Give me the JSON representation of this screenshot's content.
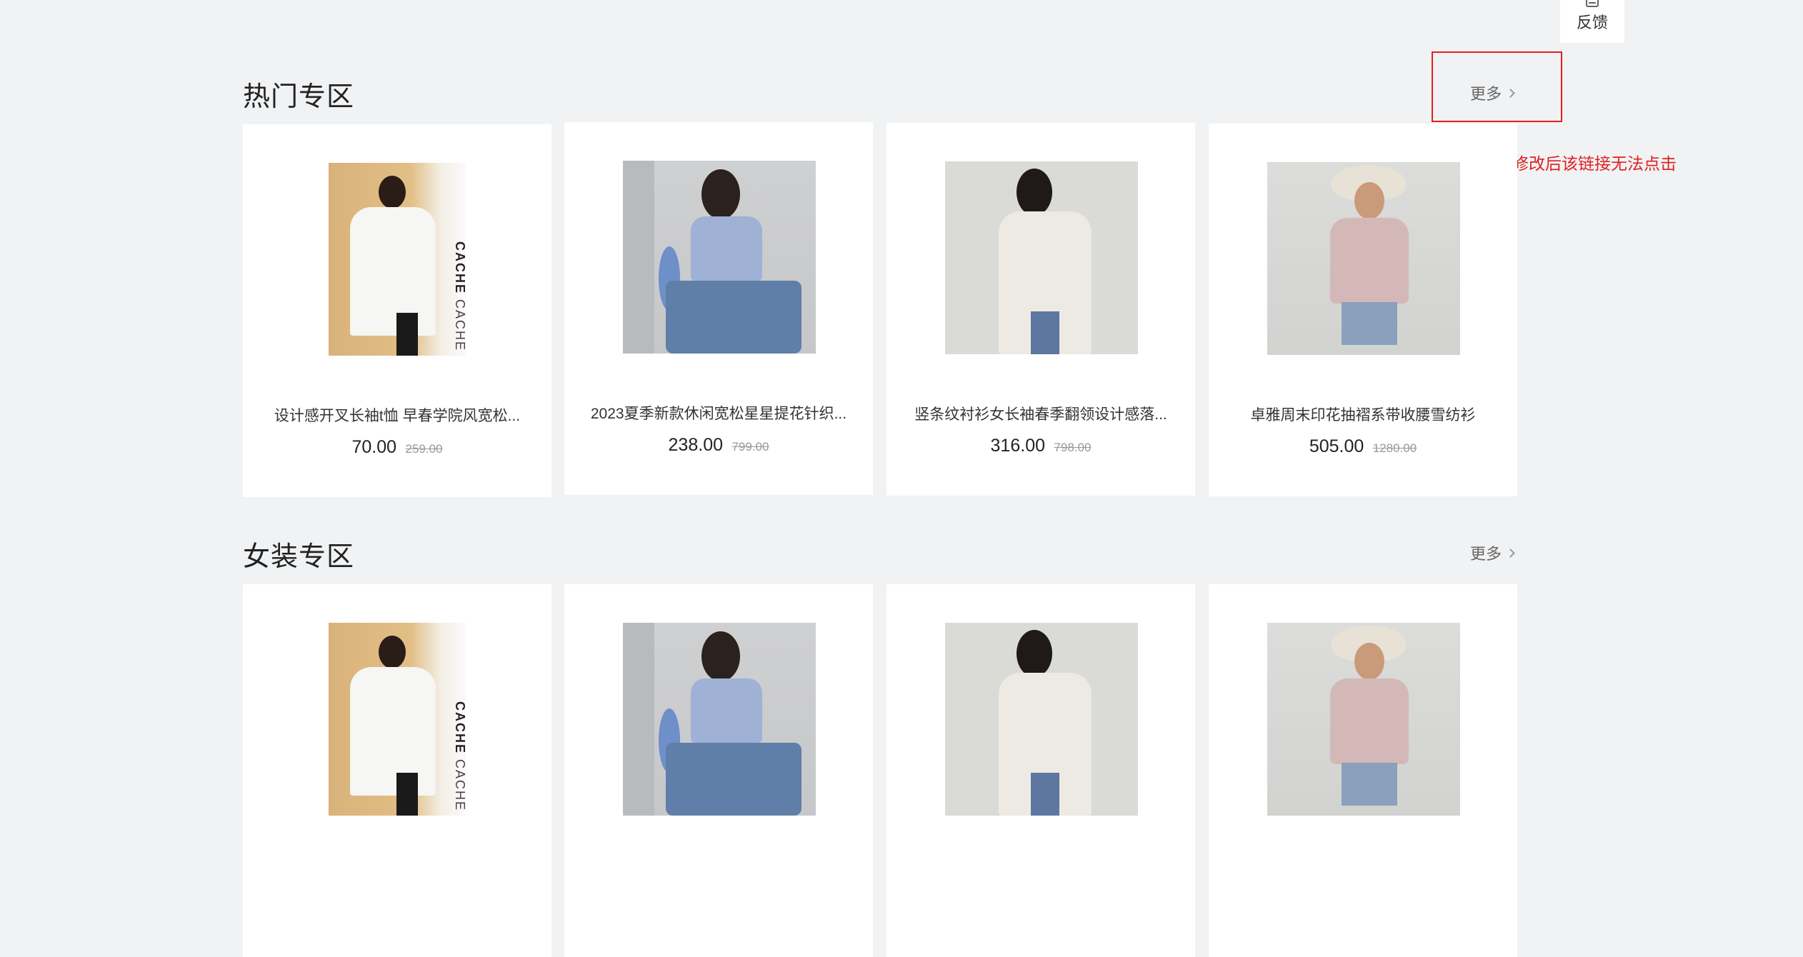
{
  "feedback": {
    "label": "反馈"
  },
  "annotation": "后台修改后该链接无法点击",
  "sections": [
    {
      "title": "热门专区",
      "more": "更多",
      "products": [
        {
          "name": "设计感开叉长袖t恤 早春学院风宽松...",
          "price": "70.00",
          "old_price": "259.00",
          "brand": "CACHE CACHE"
        },
        {
          "name": "2023夏季新款休闲宽松星星提花针织...",
          "price": "238.00",
          "old_price": "799.00"
        },
        {
          "name": "竖条纹衬衫女长袖春季翻领设计感落...",
          "price": "316.00",
          "old_price": "798.00"
        },
        {
          "name": "卓雅周末印花抽褶系带收腰雪纺衫",
          "price": "505.00",
          "old_price": "1280.00"
        }
      ]
    },
    {
      "title": "女装专区",
      "more": "更多",
      "products": [
        {
          "brand": "CACHE CACHE"
        },
        {},
        {},
        {}
      ]
    }
  ],
  "colors": {
    "background": "#f1f2f4",
    "annotation": "#e02020"
  }
}
